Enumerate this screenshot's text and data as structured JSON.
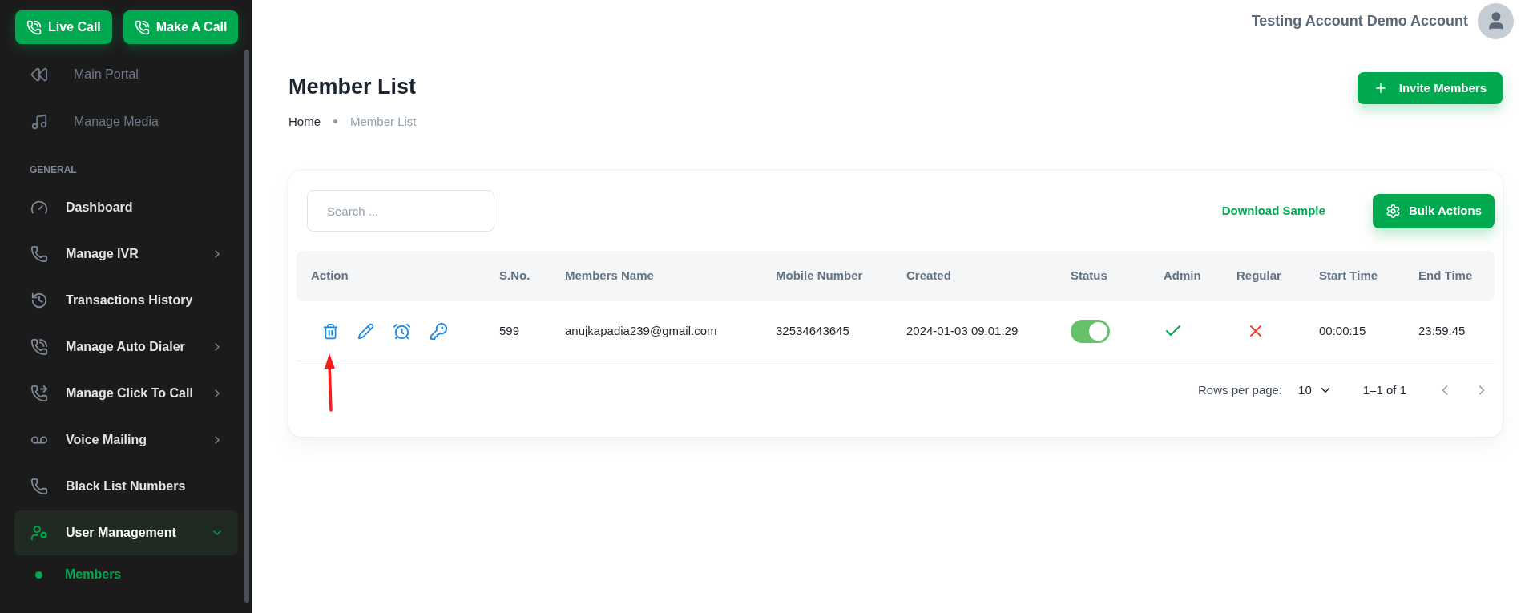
{
  "sidebar": {
    "top_buttons": [
      "Live Call",
      "Make A Call"
    ],
    "links": [
      {
        "label": "Main Portal"
      },
      {
        "label": "Manage Media"
      }
    ],
    "section_label": "GENERAL",
    "items": [
      {
        "label": "Dashboard",
        "selected": false
      },
      {
        "label": "Manage IVR",
        "expanded": false,
        "selected": false
      },
      {
        "label": "Transactions History",
        "selected": false
      },
      {
        "label": "Manage Auto Dialer",
        "expanded": false,
        "selected": false
      },
      {
        "label": "Manage Click To Call",
        "expanded": false,
        "selected": false
      },
      {
        "label": "Voice Mailing",
        "expanded": false,
        "selected": false
      },
      {
        "label": "Black List Numbers",
        "selected": false
      },
      {
        "label": "User Management",
        "expanded": true,
        "selected": true,
        "children": [
          {
            "label": "Members",
            "selected": true
          }
        ]
      }
    ]
  },
  "header": {
    "user_name": "Testing Account Demo Account"
  },
  "page": {
    "title": "Member List",
    "breadcrumbs": [
      "Home",
      "Member List"
    ],
    "invite_button": "Invite Members"
  },
  "card": {
    "search": {
      "placeholder": "Search ..."
    },
    "download_link": "Download Sample",
    "bulk_button": "Bulk Actions",
    "table": {
      "columns": [
        "Action",
        "S.No.",
        "Members Name",
        "Mobile Number",
        "Created",
        "Status",
        "Admin",
        "Regular",
        "Start Time",
        "End Time"
      ],
      "rows": [
        {
          "sno": "599",
          "name": "anujkapadia239@gmail.com",
          "mobile": "32534643645",
          "created": "2024-01-03 09:01:29",
          "status_on": true,
          "admin": true,
          "regular": false,
          "start_time": "00:00:15",
          "end_time": "23:59:45"
        }
      ]
    },
    "pagination": {
      "rows_label": "Rows per page:",
      "rows_value": "10",
      "range": "1–1 of 1"
    }
  },
  "annotation": {
    "arrow": true
  }
}
